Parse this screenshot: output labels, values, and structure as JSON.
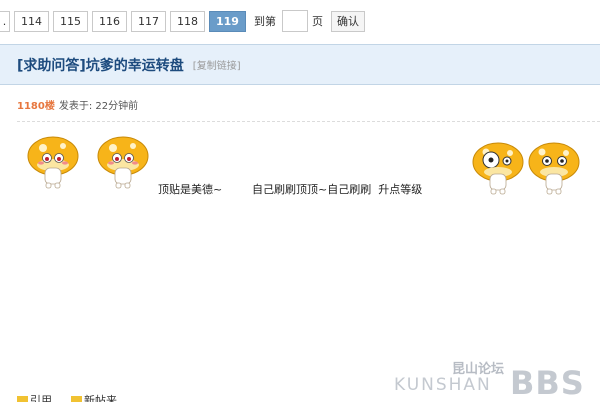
{
  "pager": {
    "pages": [
      "114",
      "115",
      "116",
      "117",
      "118"
    ],
    "current": "119",
    "goto_label": "到第",
    "page_unit": "页",
    "confirm_label": "确认"
  },
  "thread": {
    "title": "[求助问答]坑爹的幸运转盘",
    "copy_link": "[复制链接]"
  },
  "post": {
    "floor": "1180楼",
    "posted": "发表于: 22分钟前",
    "text_1": "顶贴是美德~",
    "text_2": "自己刷刷顶顶~自己刷刷  升点等级"
  },
  "footer": {
    "quote": "引用",
    "new_thread": "新帖来"
  },
  "watermark": {
    "cn": "昆山论坛",
    "en": "KUNSHAN",
    "bbs": "BBS"
  },
  "colors": {
    "pager_current": "#6a9cc9",
    "title": "#1d4b7e",
    "title_bar": "#e6f0fa",
    "floor": "#e7773f",
    "mushroom_cap": "#f7b419"
  }
}
